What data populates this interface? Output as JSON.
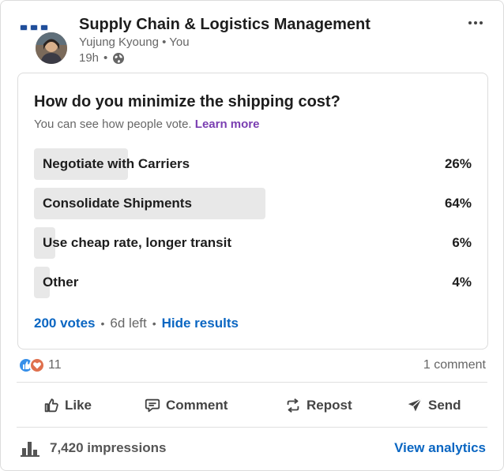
{
  "post": {
    "group_title": "Supply Chain & Logistics Management",
    "author": "Yujung Kyoung",
    "author_relation": "You",
    "age": "19h",
    "separator": "•"
  },
  "poll": {
    "question": "How do you minimize the shipping cost?",
    "note": "You can see how people vote.",
    "learn_more": "Learn more",
    "options": [
      {
        "label": "Negotiate with Carriers",
        "percent_text": "26%",
        "percent": 26
      },
      {
        "label": "Consolidate Shipments",
        "percent_text": "64%",
        "percent": 64
      },
      {
        "label": "Use cheap rate, longer transit",
        "percent_text": "6%",
        "percent": 6
      },
      {
        "label": "Other",
        "percent_text": "4%",
        "percent": 4
      }
    ],
    "votes": "200 votes",
    "time_left": "6d left",
    "hide_results": "Hide results"
  },
  "social": {
    "reaction_count": "11",
    "reaction_icons": [
      "like-icon",
      "love-icon"
    ],
    "comments": "1 comment"
  },
  "actions": {
    "like": "Like",
    "comment": "Comment",
    "repost": "Repost",
    "send": "Send"
  },
  "analytics": {
    "impressions": "7,420 impressions",
    "view_analytics": "View analytics"
  },
  "colors": {
    "link_blue": "#0a66c2",
    "learn_more_purple": "#7a3eb1",
    "poll_fill": "#e8e8e8",
    "like_blue": "#378fe9",
    "love_orange": "#df704d"
  }
}
